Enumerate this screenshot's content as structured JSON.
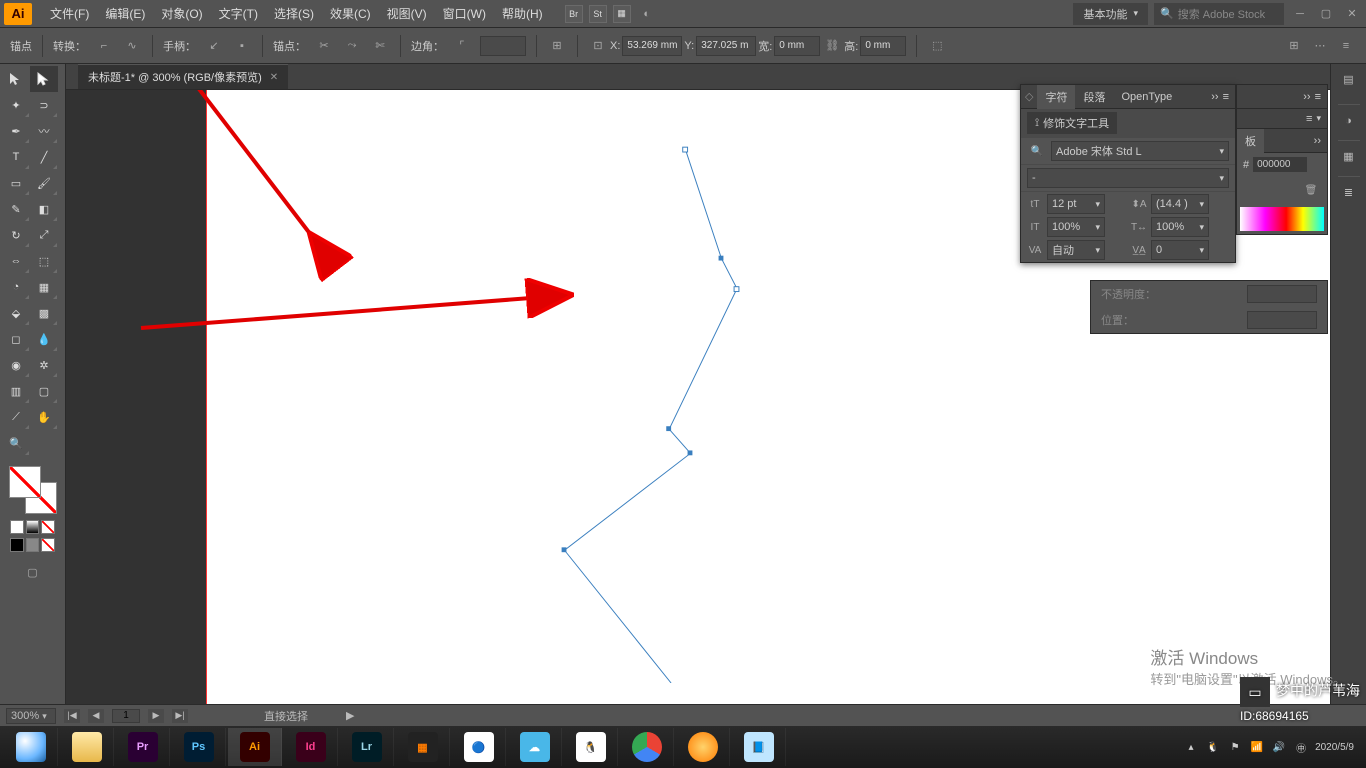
{
  "menu": {
    "items": [
      "文件(F)",
      "编辑(E)",
      "对象(O)",
      "文字(T)",
      "选择(S)",
      "效果(C)",
      "视图(V)",
      "窗口(W)",
      "帮助(H)"
    ],
    "workspace": "基本功能",
    "search_placeholder": "搜索 Adobe Stock"
  },
  "controlbar": {
    "anchor": "锚点",
    "convert": "转换：",
    "handle": "手柄：",
    "anchors": "锚点：",
    "corner": "边角：",
    "x_label": "X:",
    "x_val": "53.269 mm",
    "y_label": "Y:",
    "y_val": "327.025 m",
    "w_label": "宽:",
    "w_val": "0 mm",
    "h_label": "高:",
    "h_val": "0 mm"
  },
  "doc": {
    "tab": "未标题-1* @ 300% (RGB/像素预览)"
  },
  "char_panel": {
    "tabs": [
      "字符",
      "段落",
      "OpenType"
    ],
    "touch_btn": "修饰文字工具",
    "font": "Adobe 宋体 Std L",
    "style": "-",
    "size": "12 pt",
    "leading": "(14.4 )",
    "vscale": "100%",
    "hscale": "100%",
    "kerning": "自动",
    "tracking": "0"
  },
  "aux_panel": {
    "tab": "板",
    "hex": "000000",
    "opacity_label": "不透明度：",
    "pos_label": "位置："
  },
  "status": {
    "zoom": "300%",
    "page": "1",
    "tool": "直接选择"
  },
  "watermark": {
    "l1": "激活 Windows",
    "l2": "转到\"电脑设置\"以激活 Windows。",
    "author": "梦中的芦苇海",
    "id": "ID:68694165"
  },
  "taskbar": {
    "time": "2020/5/9"
  }
}
